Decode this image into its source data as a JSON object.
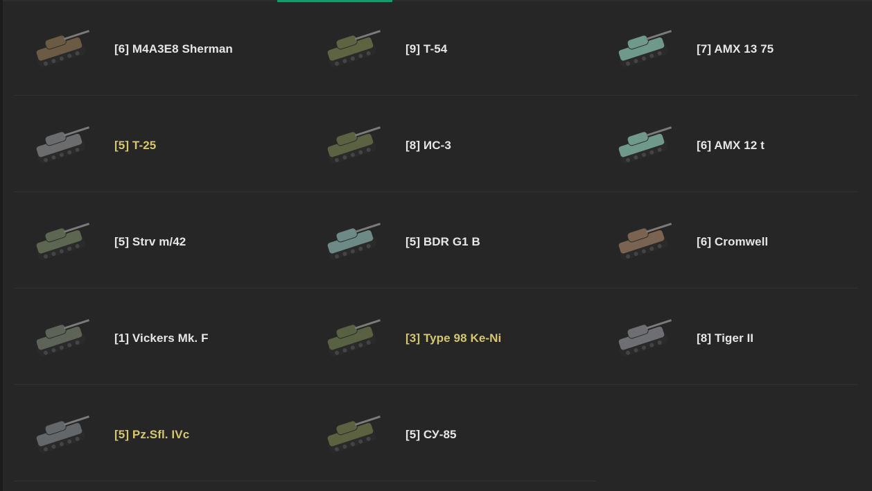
{
  "colors": {
    "background": "#262626",
    "text_normal": "#e6e6e6",
    "text_premium": "#d6c66f",
    "tab_indicator": "#1a9a6c"
  },
  "vehicles": [
    {
      "label": "[6] M4A3E8 Sherman",
      "premium": false,
      "icon": "tank-icon",
      "tint": "#6b5a44"
    },
    {
      "label": "[9] T-54",
      "premium": false,
      "icon": "tank-icon",
      "tint": "#5e6442"
    },
    {
      "label": "[7] AMX 13 75",
      "premium": false,
      "icon": "tank-icon",
      "tint": "#6f9a8b"
    },
    {
      "label": "[5] T-25",
      "premium": true,
      "icon": "tank-icon",
      "tint": "#6a6c6e"
    },
    {
      "label": "[8] ИС-3",
      "premium": false,
      "icon": "tank-icon",
      "tint": "#5a6242"
    },
    {
      "label": "[6] AMX 12 t",
      "premium": false,
      "icon": "tank-icon",
      "tint": "#6f9a8b"
    },
    {
      "label": "[5] Strv m/42",
      "premium": false,
      "icon": "tank-icon",
      "tint": "#5c6650"
    },
    {
      "label": "[5] BDR G1 B",
      "premium": false,
      "icon": "tank-icon",
      "tint": "#6d8a87"
    },
    {
      "label": "[6] Cromwell",
      "premium": false,
      "icon": "tank-icon",
      "tint": "#7a6350"
    },
    {
      "label": "[1] Vickers Mk. F",
      "premium": false,
      "icon": "tank-icon",
      "tint": "#5d6356"
    },
    {
      "label": "[3] Type 98 Ke-Ni",
      "premium": true,
      "icon": "tank-icon",
      "tint": "#586142"
    },
    {
      "label": "[8] Tiger II",
      "premium": false,
      "icon": "tank-icon",
      "tint": "#6e6f72"
    },
    {
      "label": "[5] Pz.Sfl. IVc",
      "premium": true,
      "icon": "tank-icon",
      "tint": "#646769"
    },
    {
      "label": "[5] СУ-85",
      "premium": false,
      "icon": "tank-icon",
      "tint": "#5c6240"
    }
  ]
}
